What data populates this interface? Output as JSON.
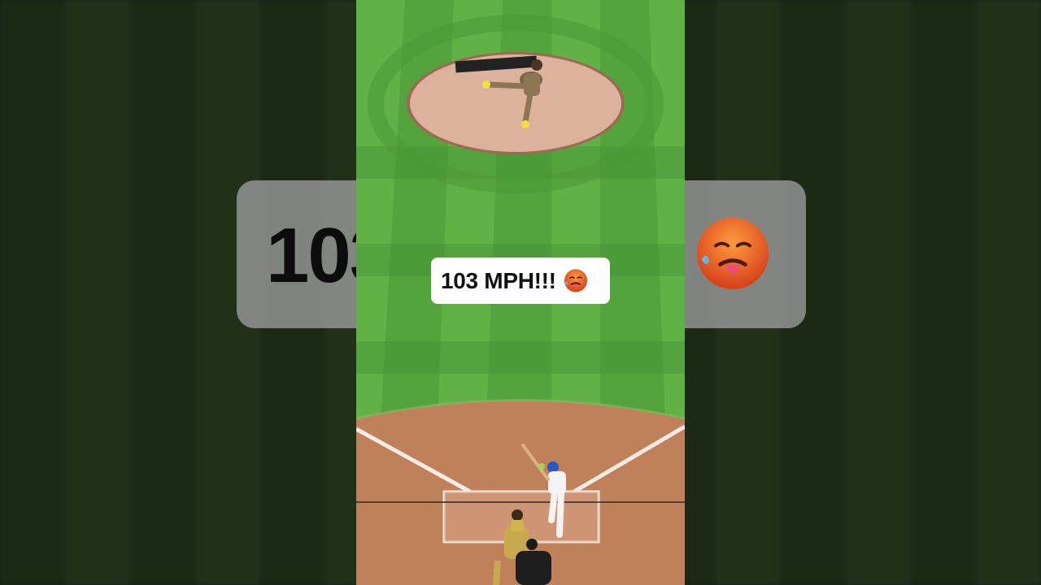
{
  "caption": {
    "text": "103 MPH!!!",
    "emoji": "hot-face-emoji"
  },
  "backdrop_caption": {
    "text": "103"
  },
  "colors": {
    "grass_light": "#5cab43",
    "grass_dark": "#3f8a30",
    "dirt": "#c0805a",
    "mound": "#dcb29d",
    "caption_bg": "#ffffff"
  }
}
